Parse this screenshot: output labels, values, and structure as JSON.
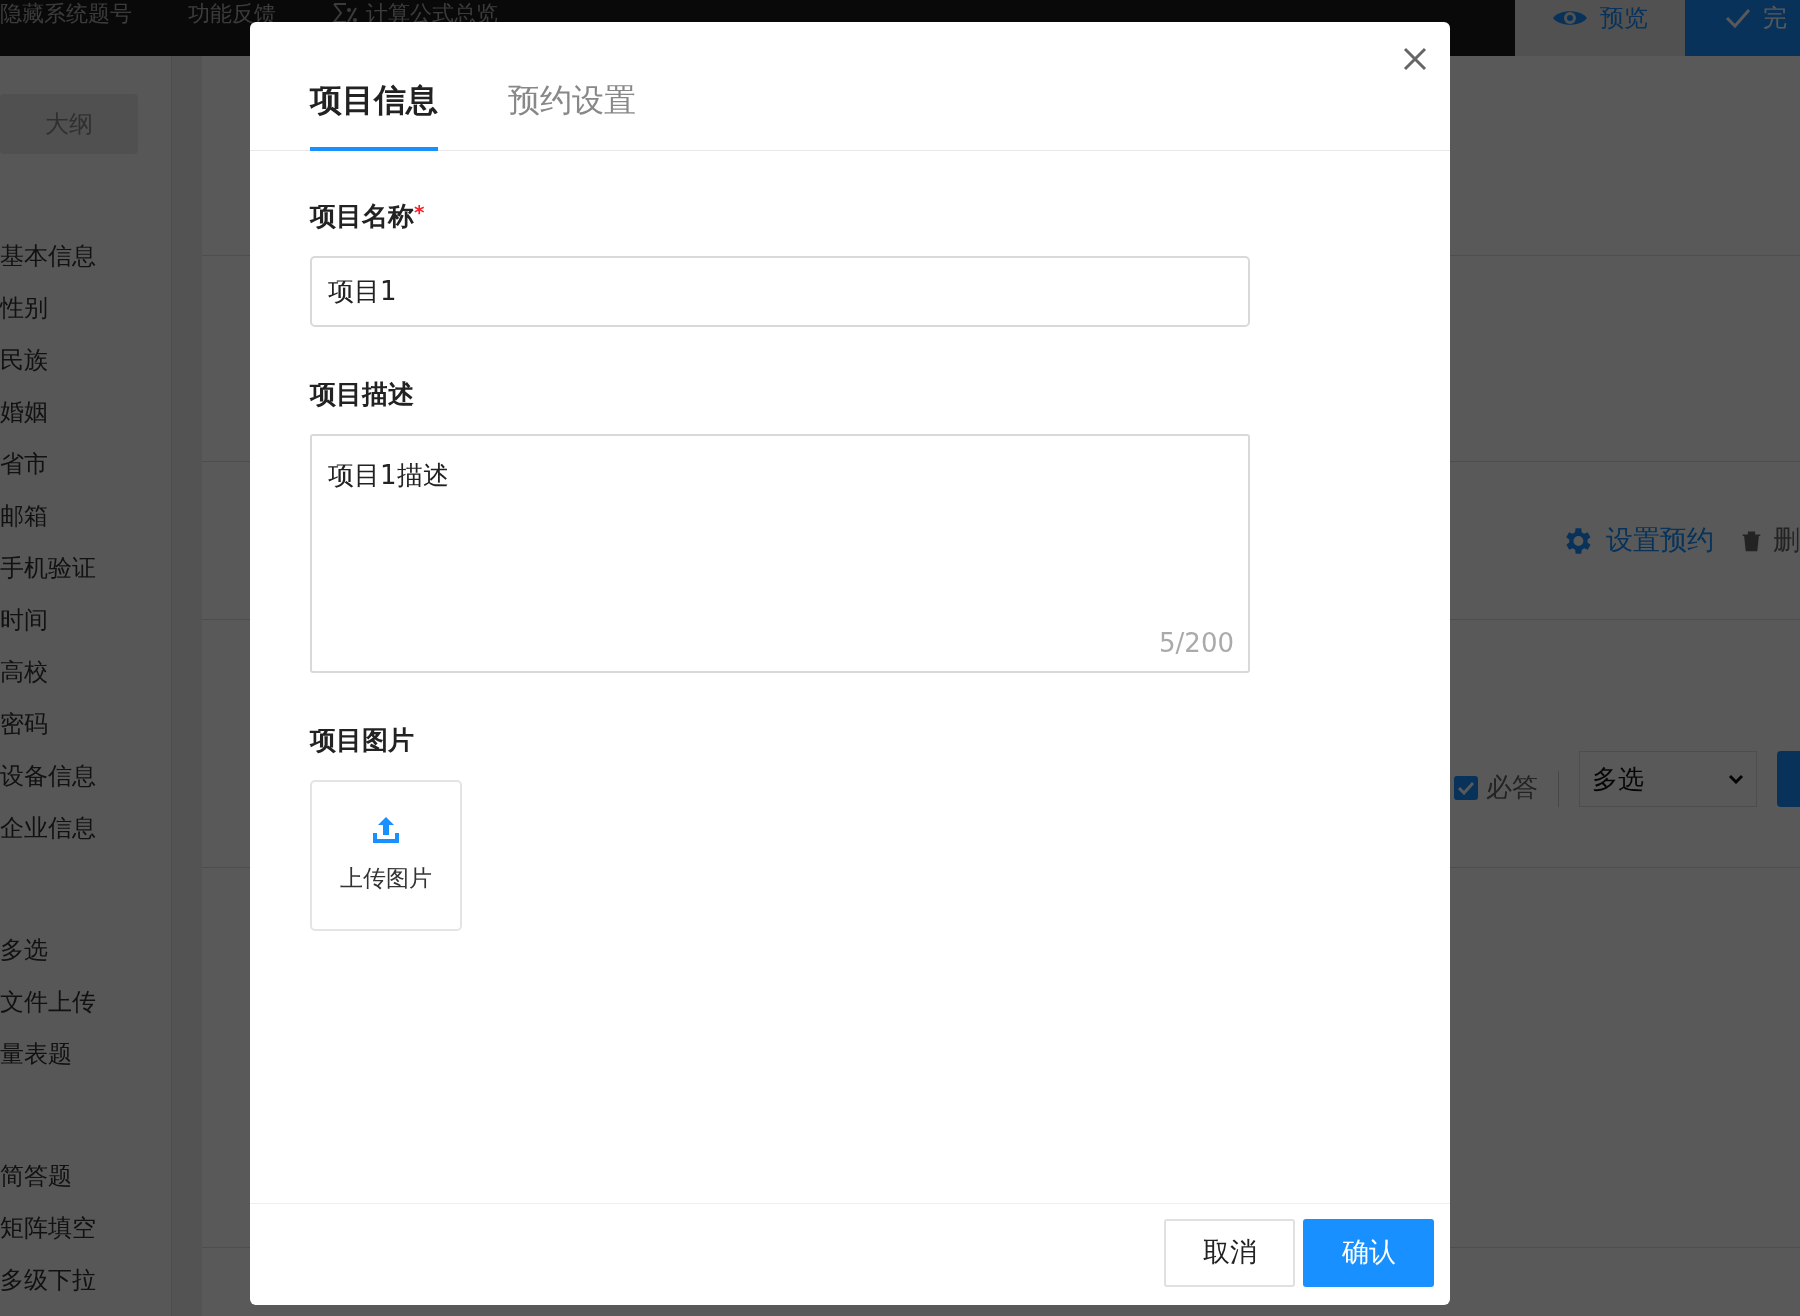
{
  "top_bar": {
    "items": [
      {
        "kind": "text",
        "label": "隐藏系统题号"
      },
      {
        "kind": "text",
        "label": "功能反馈"
      },
      {
        "kind": "formula",
        "label": "计算公式总览"
      }
    ],
    "preview_button": "预览",
    "finish_button": "完"
  },
  "sidebar": {
    "outline_button": "大纲",
    "groups": [
      [
        "基本信息",
        "性别",
        "民族",
        "婚姻",
        "省市",
        "邮箱",
        "手机验证",
        "时间",
        "高校",
        "密码",
        "设备信息",
        "企业信息"
      ],
      [
        "多选",
        "文件上传",
        "量表题"
      ],
      [
        "简答题",
        "矩阵填空",
        "多级下拉"
      ]
    ]
  },
  "question_toolbar": {
    "settings_link": "设置预约",
    "delete_link": "删"
  },
  "question_options": {
    "required": {
      "label": "必答",
      "checked": true
    },
    "type_select": "多选"
  },
  "dialog": {
    "tabs": [
      {
        "label": "项目信息",
        "selected": true
      },
      {
        "label": "预约设置",
        "selected": false
      }
    ],
    "name_field": {
      "label": "项目名称",
      "required": true,
      "required_mark": "*",
      "value": "项目1"
    },
    "description_field": {
      "label": "项目描述",
      "value": "项目1描述",
      "counter": "5/200"
    },
    "image_field": {
      "label": "项目图片",
      "upload_label": "上传图片"
    },
    "buttons": [
      {
        "label": "取消",
        "kind": "secondary"
      },
      {
        "label": "确认",
        "kind": "primary"
      }
    ]
  }
}
